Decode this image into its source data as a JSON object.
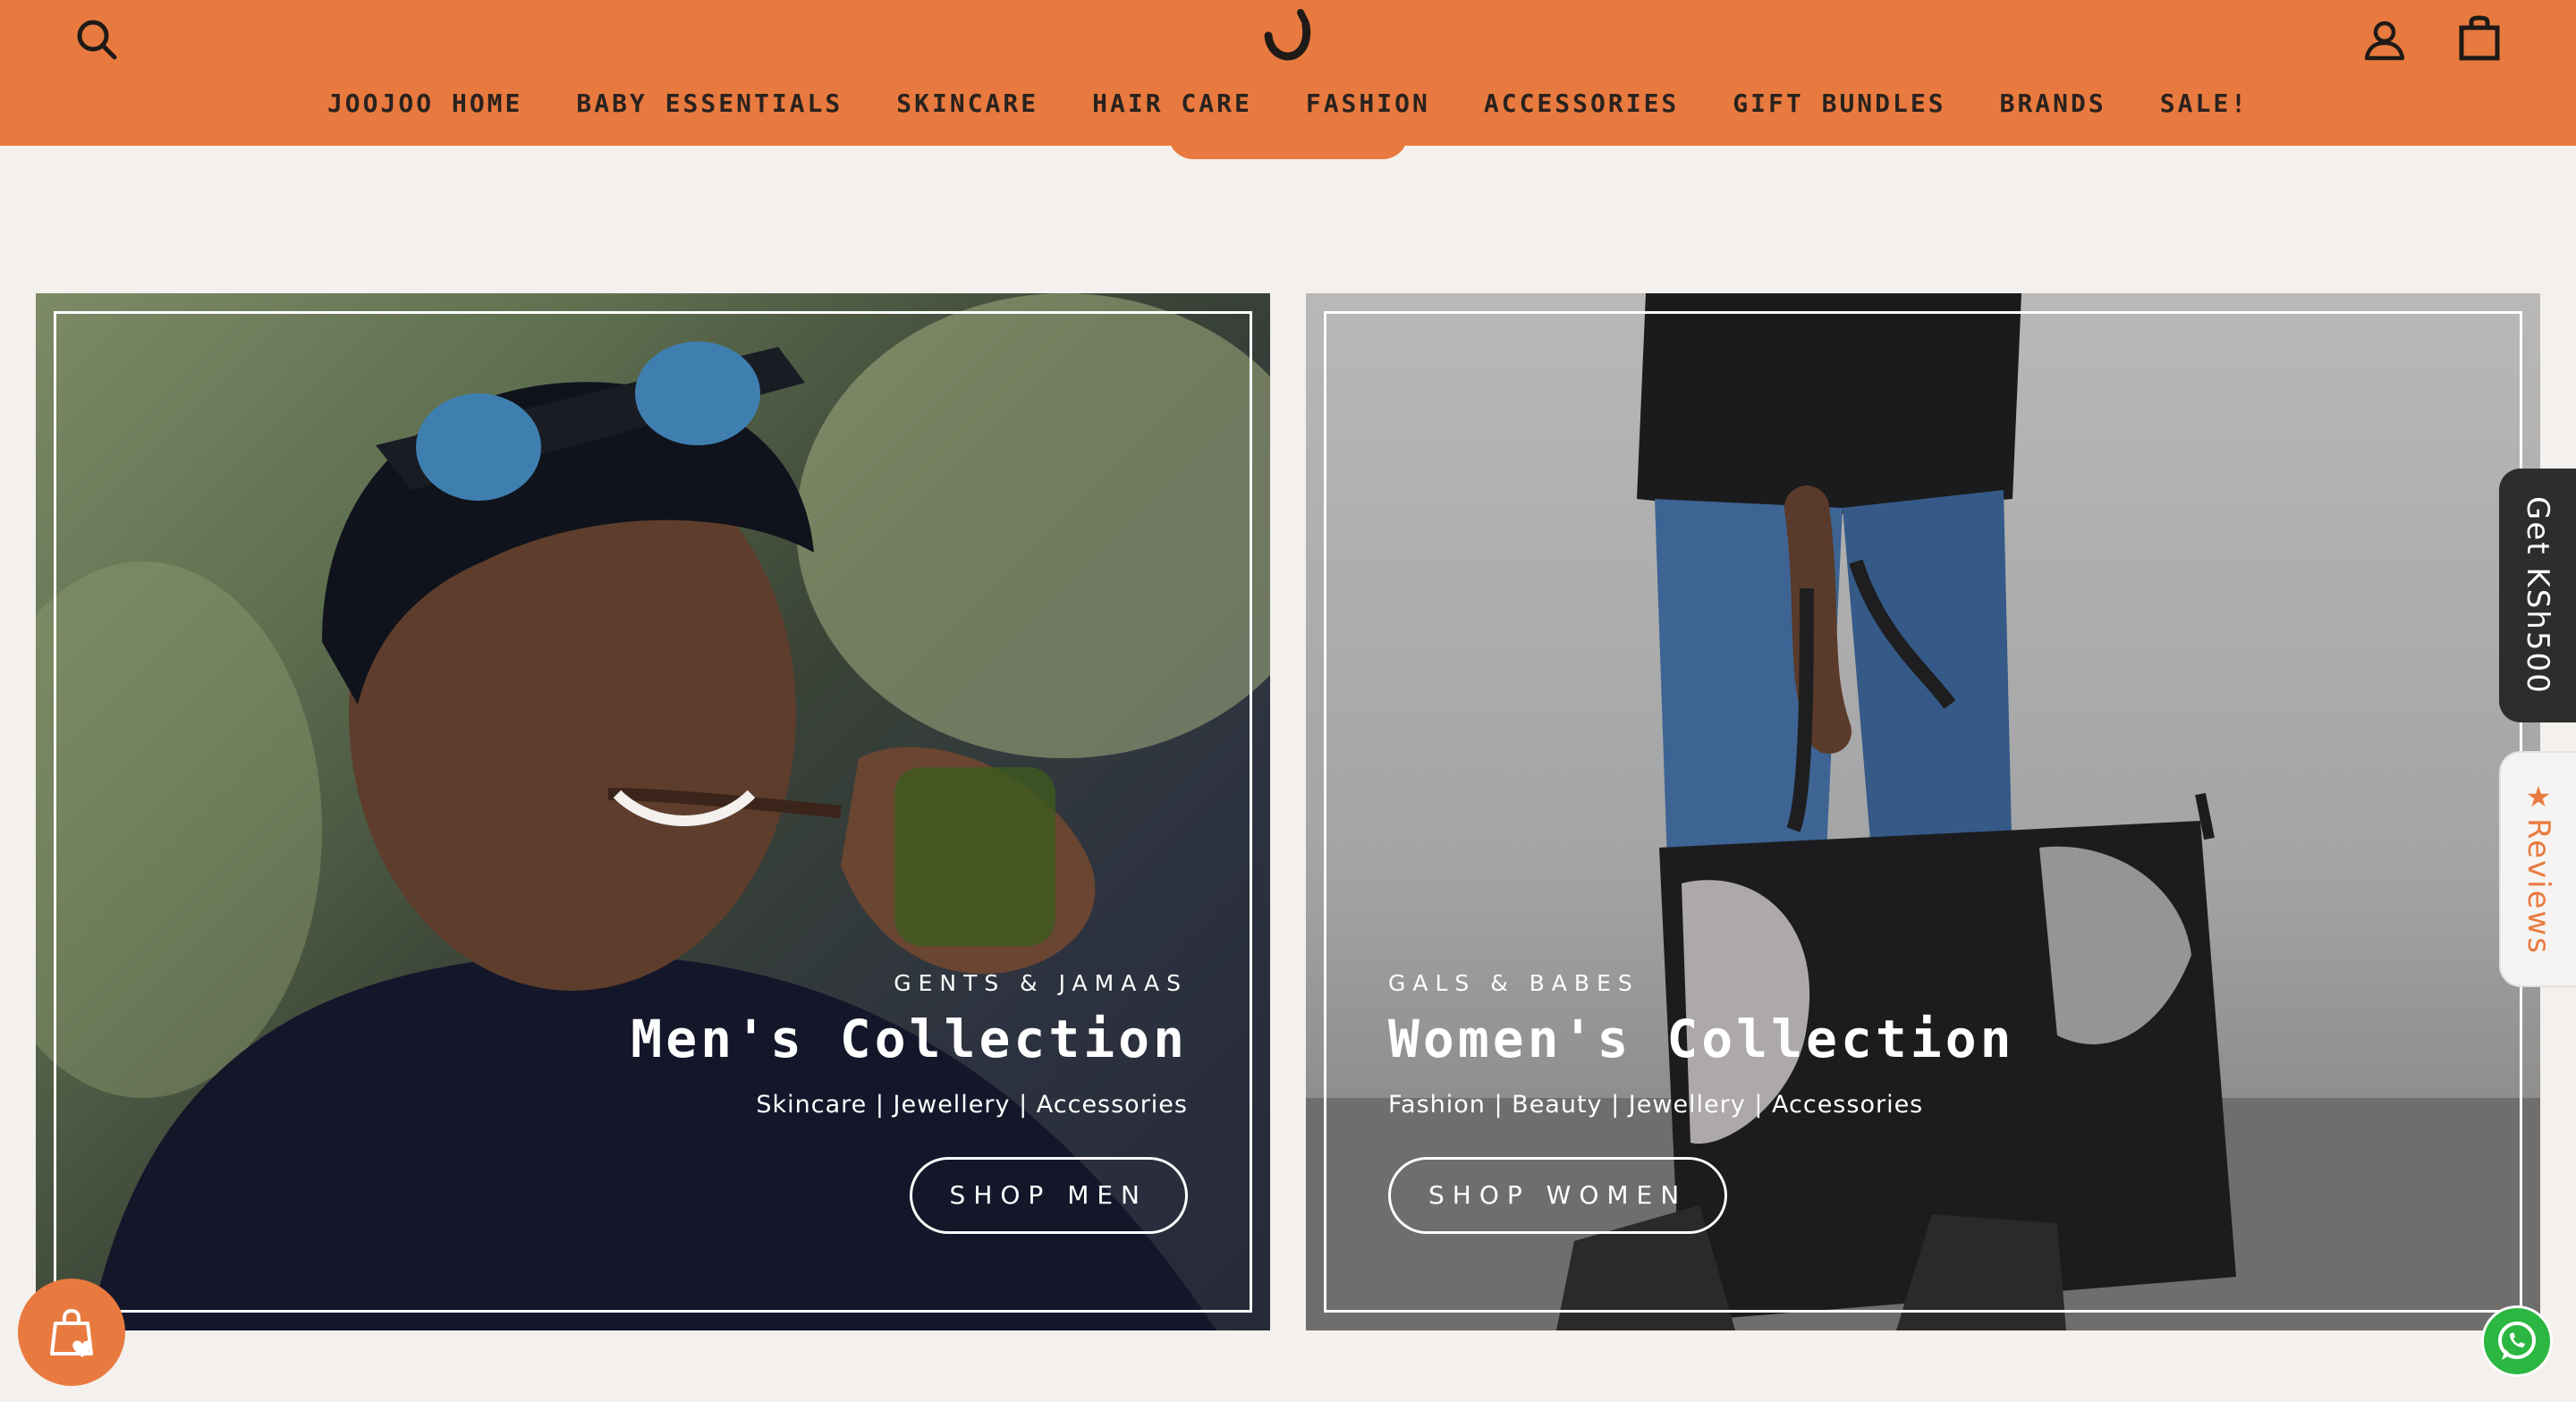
{
  "header": {
    "search_icon": "search-icon",
    "logo_icon": "joojoo-logo",
    "account_icon": "account-icon",
    "cart_icon": "shopping-bag-icon",
    "background_color": "#e97a3f"
  },
  "nav": {
    "items": [
      {
        "label": "JOOJOO HOME"
      },
      {
        "label": "BABY ESSENTIALS"
      },
      {
        "label": "SKINCARE"
      },
      {
        "label": "HAIR CARE"
      },
      {
        "label": "FASHION"
      },
      {
        "label": "ACCESSORIES"
      },
      {
        "label": "GIFT BUNDLES"
      },
      {
        "label": "BRANDS"
      },
      {
        "label": "SALE!"
      }
    ]
  },
  "collections": {
    "men": {
      "eyebrow": "GENTS & JAMAAS",
      "title": "Men's Collection",
      "subtitle": "Skincare | Jewellery | Accessories",
      "button": "SHOP MEN"
    },
    "women": {
      "eyebrow": "GALS & BABES",
      "title": "Women's Collection",
      "subtitle": "Fashion | Beauty | Jewellery | Accessories",
      "button": "SHOP WOMEN"
    }
  },
  "side_tabs": {
    "promo": "Get KSh500",
    "reviews": "Reviews"
  },
  "floating": {
    "bag_icon": "shopping-bag-heart-icon",
    "whatsapp_icon": "whatsapp-icon"
  },
  "colors": {
    "accent": "#e97a3f",
    "page_bg": "#f3f0ee",
    "promo_bg": "#2d2d2d",
    "whatsapp": "#2bb741"
  }
}
